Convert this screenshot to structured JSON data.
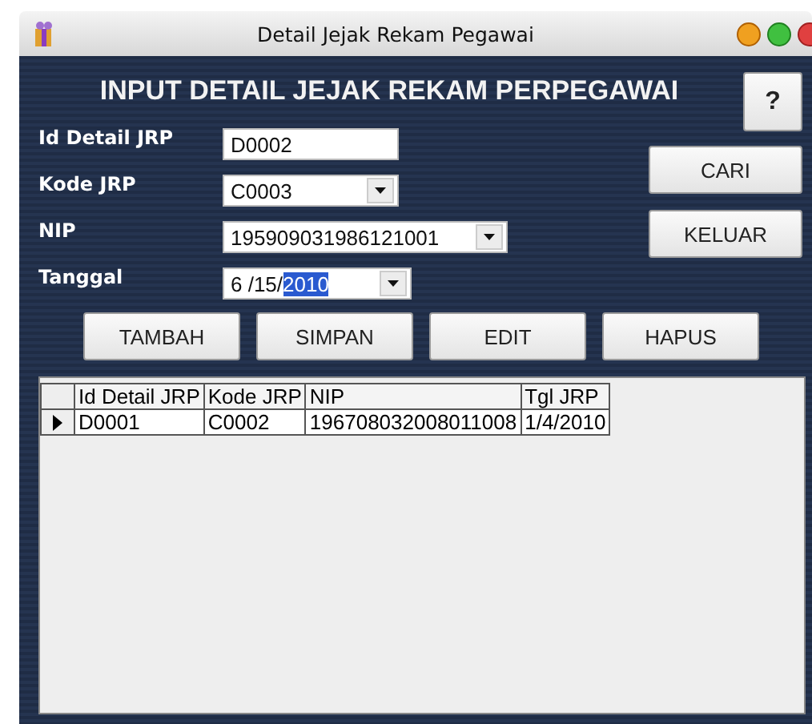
{
  "window": {
    "title": "Detail Jejak Rekam Pegawai"
  },
  "heading": "INPUT DETAIL JEJAK REKAM PERPEGAWAI",
  "help_button": "?",
  "fields": [
    {
      "kind": "text",
      "label": "Id Detail JRP",
      "value": "D0002"
    },
    {
      "kind": "combo",
      "label": "Kode JRP",
      "value": "C0003"
    },
    {
      "kind": "combo",
      "label": "NIP",
      "value": "195909031986121001"
    },
    {
      "kind": "date",
      "label": "Tanggal",
      "value": "6 /15/",
      "selected_text": "2010"
    }
  ],
  "side_buttons": [
    "CARI",
    "KELUAR"
  ],
  "action_buttons": [
    "TAMBAH",
    "SIMPAN",
    "EDIT",
    "HAPUS"
  ],
  "table": {
    "columns": [
      "Id Detail JRP",
      "Kode JRP",
      "NIP",
      "Tgl JRP"
    ],
    "rows": [
      {
        "current": true,
        "cells": [
          "D0001",
          "C0002",
          "196708032008011008",
          "1/4/2010"
        ]
      }
    ]
  }
}
